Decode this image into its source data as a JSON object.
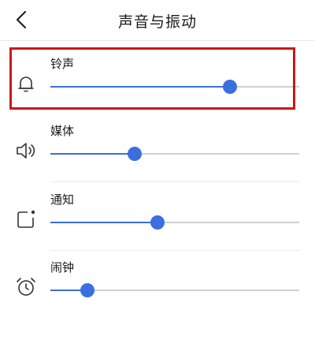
{
  "header": {
    "title": "声音与振动"
  },
  "highlight_color": "#c8191c",
  "accent_color": "#3b6fe0",
  "rows": [
    {
      "label": "铃声",
      "icon": "bell-icon",
      "level": 0.72
    },
    {
      "label": "媒体",
      "icon": "speaker-icon",
      "level": 0.34
    },
    {
      "label": "通知",
      "icon": "notification-icon",
      "level": 0.43
    },
    {
      "label": "闹钟",
      "icon": "alarm-clock-icon",
      "level": 0.15
    }
  ]
}
